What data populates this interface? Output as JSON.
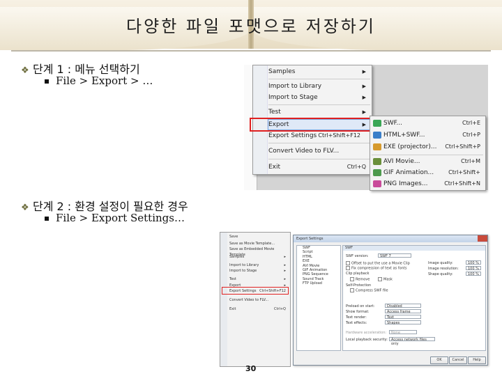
{
  "title": "다양한 파일 포맷으로 저장하기",
  "step1": {
    "heading": "단계 1 : 메뉴 선택하기",
    "path": "File > Export > …"
  },
  "step2": {
    "heading": "단계 2 : 환경 설정이 필요한 경우",
    "path": "File > Export Settings…"
  },
  "menu1": {
    "items": [
      {
        "label": "Samples",
        "submenu": true,
        "shortcut": ""
      },
      {
        "label": "Import to Library",
        "submenu": true,
        "shortcut": ""
      },
      {
        "label": "Import to Stage",
        "submenu": true,
        "shortcut": ""
      },
      {
        "label": "Test",
        "submenu": true,
        "shortcut": ""
      },
      {
        "label": "Export",
        "submenu": true,
        "shortcut": ""
      },
      {
        "label": "Export Settings",
        "submenu": false,
        "shortcut": "Ctrl+Shift+F12"
      },
      {
        "label": "Convert Video to FLV...",
        "submenu": false,
        "shortcut": ""
      },
      {
        "label": "Exit",
        "submenu": false,
        "shortcut": "Ctrl+Q"
      }
    ],
    "highlighted": "Export"
  },
  "export_submenu": {
    "items": [
      {
        "label": "SWF...",
        "shortcut": "Ctrl+E",
        "icon": "swf-icon",
        "color": "#3aa655"
      },
      {
        "label": "HTML+SWF...",
        "shortcut": "Ctrl+P",
        "icon": "html-icon",
        "color": "#3a7fc9"
      },
      {
        "label": "EXE (projector)...",
        "shortcut": "Ctrl+Shift+P",
        "icon": "exe-icon",
        "color": "#d69a2d"
      },
      {
        "label": "AVI Movie...",
        "shortcut": "Ctrl+M",
        "icon": "avi-icon",
        "color": "#6a8f3a"
      },
      {
        "label": "GIF Animation...",
        "shortcut": "Ctrl+Shift+",
        "icon": "gif-icon",
        "color": "#4d9a4d"
      },
      {
        "label": "PNG Images...",
        "shortcut": "Ctrl+Shift+N",
        "icon": "png-icon",
        "color": "#c94b9a"
      }
    ]
  },
  "menu2": {
    "items": [
      {
        "label": "Save",
        "shortcut": ""
      },
      {
        "label": "Save as Movie Template...",
        "shortcut": ""
      },
      {
        "label": "Save as Embedded Movie Template",
        "shortcut": ""
      },
      {
        "label": "Samples",
        "shortcut": ""
      },
      {
        "label": "Import to Library",
        "shortcut": ""
      },
      {
        "label": "Import to Stage",
        "shortcut": ""
      },
      {
        "label": "Test",
        "shortcut": ""
      },
      {
        "label": "Export",
        "shortcut": ""
      },
      {
        "label": "Export Settings",
        "shortcut": "Ctrl+Shift+F12"
      },
      {
        "label": "Convert Video to FLV...",
        "shortcut": ""
      },
      {
        "label": "Exit",
        "shortcut": "Ctrl+Q"
      }
    ]
  },
  "dialog": {
    "title": "Export Settings",
    "tree": [
      "SWF",
      "Script",
      "HTML",
      "EXE",
      "AVI Movie",
      "GIF Animation",
      "PNG Sequence",
      "Sound Track",
      "FTP Upload"
    ],
    "pane_header": "SWF",
    "swf_version_label": "SWF version:",
    "swf_version_value": "SWF 7",
    "image_quality_label": "Image quality:",
    "image_quality_value": "100 %",
    "image_resolution_label": "Image resolution:",
    "image_resolution_value": "100 %",
    "shape_quality_label": "Shape quality:",
    "shape_quality_value": "100 %",
    "options": [
      "Offset to put the use a Movie Clip",
      "Fix compression of text as fonts",
      "Clip playback",
      "Remove",
      "Mask",
      "Self-Protection",
      "Compress SWF file"
    ],
    "preload_label": "Preload on start:",
    "preload_value": "Disabled",
    "show_format_label": "Show format:",
    "show_format_value": "Access frame",
    "text_render_label": "Text render:",
    "text_render_value": "Text",
    "text_effects_label": "Text effects:",
    "text_effects_value": "Shapes",
    "hardware_label": "Hardware acceleration:",
    "hardware_value": "None",
    "local_playback_label": "Local playback security:",
    "local_playback_value": "Access network files only",
    "ok_label": "OK",
    "cancel_label": "Cancel",
    "help_label": "Help"
  },
  "page_number": "30"
}
